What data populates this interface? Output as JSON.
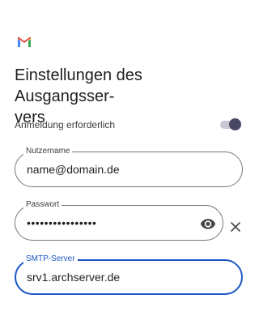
{
  "header": {
    "logo_icon": "gmail-logo-icon",
    "title": "Einstellungen des Ausgangsser-\nvers"
  },
  "login_required": {
    "label": "Anmeldung erforderlich",
    "enabled": true
  },
  "fields": {
    "username": {
      "label": "Nutzername",
      "value": "name@domain.de"
    },
    "password": {
      "label": "Passwort",
      "value": "••••••••••••••••",
      "toggle_icon": "eye-icon",
      "clear_icon": "close-icon"
    },
    "smtp_server": {
      "label": "SMTP-Server",
      "value": "srv1.archserver.de"
    }
  },
  "colors": {
    "accent": "#1a56c4",
    "toggle_thumb": "#4a4766",
    "toggle_track": "#c9c7d6"
  }
}
